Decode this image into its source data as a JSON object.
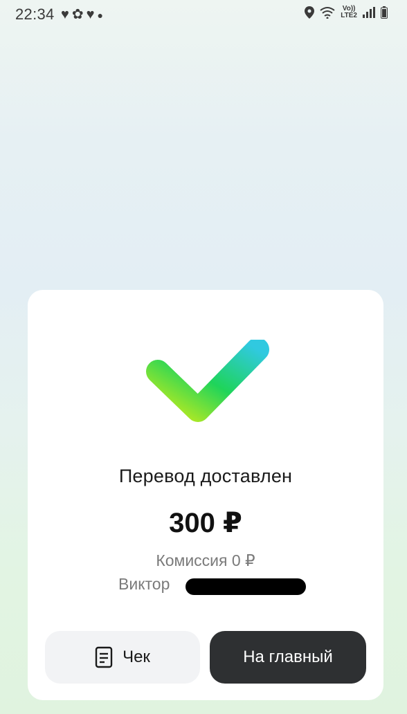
{
  "status_bar": {
    "time": "22:34",
    "notification_icons": [
      "heart-icon",
      "flower-icon",
      "heart-icon",
      "dot"
    ],
    "network_label_top": "Vo))",
    "network_label_bottom": "LTE2"
  },
  "result": {
    "title": "Перевод доставлен",
    "amount": "300 ₽",
    "commission": "Комиссия 0 ₽",
    "recipient_first_name": "Виктор"
  },
  "buttons": {
    "receipt_label": "Чек",
    "home_label": "На главный"
  },
  "colors": {
    "check_gradient_start": "#c6ec1c",
    "check_gradient_mid": "#1fd45a",
    "check_gradient_end": "#30c9e0",
    "primary_button": "#2e3032",
    "secondary_button": "#f2f3f5"
  }
}
